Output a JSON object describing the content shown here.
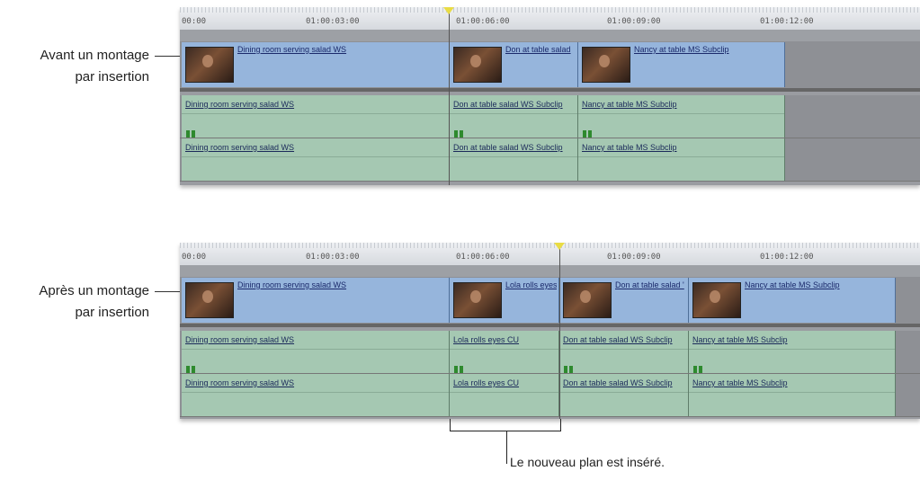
{
  "labels": {
    "before_line1": "Avant un montage",
    "before_line2": "par insertion",
    "after_line1": "Après un montage",
    "after_line2": "par insertion",
    "note": "Le nouveau plan est inséré."
  },
  "ruler": {
    "timecodes": [
      "00:00",
      "01:00:03:00",
      "01:00:06:00",
      "01:00:09:00",
      "01:00:12:00"
    ]
  },
  "before": {
    "video": [
      {
        "name": "Dining room serving salad WS"
      },
      {
        "name": "Don at table salad"
      },
      {
        "name": "Nancy at table MS Subclip"
      }
    ],
    "audio1": [
      {
        "name": "Dining room serving salad WS"
      },
      {
        "name": "Don at table salad WS Subclip"
      },
      {
        "name": "Nancy at table MS Subclip"
      }
    ],
    "audio2": [
      {
        "name": "Dining room serving salad WS"
      },
      {
        "name": "Don at table salad WS Subclip"
      },
      {
        "name": "Nancy at table MS Subclip"
      }
    ]
  },
  "after": {
    "video": [
      {
        "name": "Dining room serving salad WS"
      },
      {
        "name": "Lola rolls eyes"
      },
      {
        "name": "Don at table salad '"
      },
      {
        "name": "Nancy at table MS Subclip"
      }
    ],
    "audio1": [
      {
        "name": "Dining room serving salad WS"
      },
      {
        "name": "Lola rolls eyes CU"
      },
      {
        "name": "Don at table salad WS Subclip"
      },
      {
        "name": "Nancy at table MS Subclip"
      }
    ],
    "audio2": [
      {
        "name": "Dining room serving salad WS"
      },
      {
        "name": "Lola rolls eyes CU"
      },
      {
        "name": "Don at table salad WS Subclip"
      },
      {
        "name": "Nancy at table MS Subclip"
      }
    ]
  },
  "colors": {
    "video_clip": "#96b5dc",
    "audio_clip": "#a5c8b2",
    "playhead_marker": "#e9dc44"
  }
}
